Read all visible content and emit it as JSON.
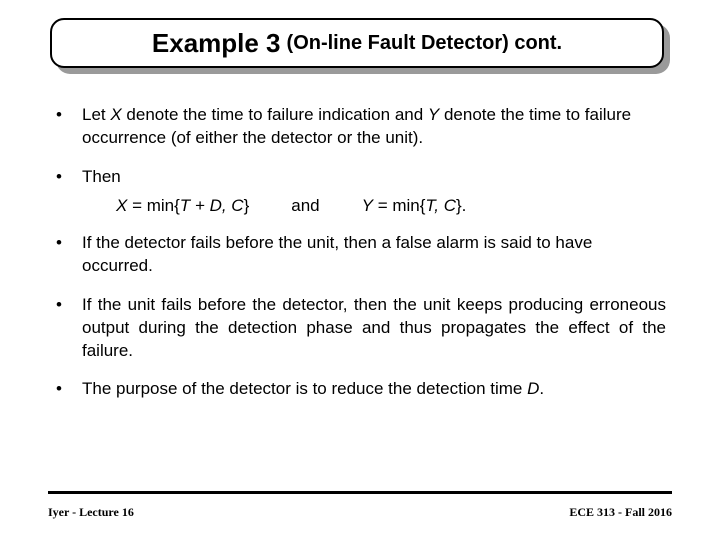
{
  "title": {
    "main": "Example 3",
    "sub": "(On-line Fault Detector) cont."
  },
  "bullets": {
    "b1_pre": "Let ",
    "b1_var1": "X",
    "b1_mid": " denote the time to failure indication and ",
    "b1_var2": "Y",
    "b1_post": " denote the time to failure occurrence (of either the detector or the unit).",
    "b2": "Then",
    "eq1_lhs": "X",
    "eq1_eq": " = min{",
    "eq1_inner1": "T",
    "eq1_plus": " + ",
    "eq1_inner2": "D, C",
    "eq1_close": "}",
    "eq_and": "and",
    "eq2_lhs": "Y",
    "eq2_eq": " = min{",
    "eq2_inner": "T, C",
    "eq2_close": "}.",
    "b3": "If the detector fails before the unit, then a false alarm is said to have occurred.",
    "b4": "If the unit fails before the detector, then the unit keeps producing erroneous output during the detection phase and thus propagates the effect of the failure.",
    "b5_pre": "The purpose of the detector is to reduce the detection time ",
    "b5_var": "D",
    "b5_post": "."
  },
  "footer": {
    "left": "Iyer - Lecture 16",
    "right": "ECE 313 - Fall 2016"
  }
}
